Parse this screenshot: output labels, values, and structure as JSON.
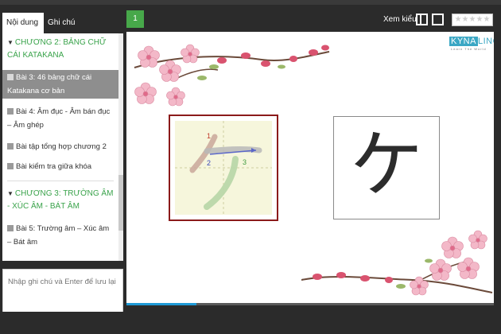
{
  "sidebar": {
    "tabs": [
      "Nội dung",
      "Ghi chú"
    ],
    "chapters": [
      "CHƯƠNG 2: BẢNG CHỮ CÁI KATAKANA",
      "CHƯƠNG 3: TRƯỜNG ÂM - XÚC ÂM - BÁT ÂM"
    ],
    "items": [
      "Bài 3: 46 bảng chữ cái Katakana cơ bản",
      "Bài 4: Âm đục - Âm bán đục – Âm ghép",
      "Bài tập tổng hợp chương 2",
      "Bài kiểm tra giữa khóa",
      "Bài 5: Trường âm – Xúc âm – Bát âm"
    ],
    "note_placeholder": "Nhập ghi chú và Enter để lưu lại"
  },
  "header": {
    "page_number": "1",
    "view_label": "Xem kiểu",
    "rating_stars": "★★★★★"
  },
  "stage": {
    "logo_kyna": "KYNA",
    "logo_lingo": "LINGO",
    "logo_tagline": "Learn The World",
    "stroke_numbers": [
      "1",
      "2",
      "3"
    ],
    "character": "ケ"
  },
  "progress": {
    "value": 0.19
  },
  "colors": {
    "accent": "#47a84a",
    "chapter": "#3aa34b",
    "active_item": "#8e8e8e",
    "progress": "#1f9ad6",
    "frame": "#8b1a1a"
  }
}
